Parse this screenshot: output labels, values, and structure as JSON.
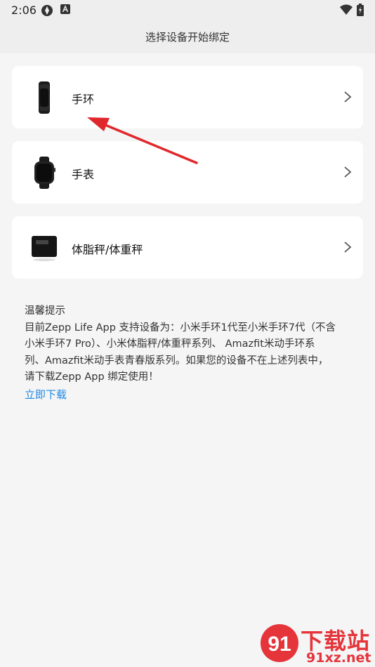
{
  "status_bar": {
    "time": "2:06"
  },
  "header": {
    "title": "选择设备开始绑定"
  },
  "devices": [
    {
      "label": "手环",
      "icon": "band-icon"
    },
    {
      "label": "手表",
      "icon": "watch-icon"
    },
    {
      "label": "体脂秤/体重秤",
      "icon": "scale-icon"
    }
  ],
  "tips": {
    "title": "温馨提示",
    "lines": [
      "目前Zepp Life App 支持设备为：小米手环1代至小米手环7代（不含",
      "小米手环7 Pro）、小米体脂秤/体重秤系列、 Amazfit米动手环系",
      "列、Amazfit米动手表青春版系列。如果您的设备不在上述列表中，",
      "请下载Zepp App 绑定使用！"
    ],
    "link": "立即下载"
  },
  "watermark": {
    "brand": "下载站",
    "domain": "91xz.net",
    "logo_number": "91"
  },
  "colors": {
    "link": "#1e88e5",
    "annotation_arrow": "#e0282c",
    "watermark": "#e5343a"
  }
}
